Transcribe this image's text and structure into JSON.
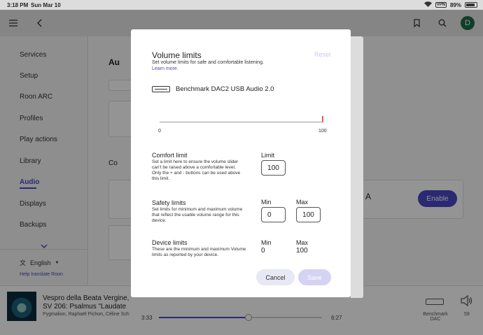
{
  "status_bar": {
    "time": "3:18 PM",
    "date": "Sun Mar 10",
    "battery": "89%",
    "battery_level": 0.89
  },
  "sidebar": {
    "items": [
      {
        "label": "Services"
      },
      {
        "label": "Setup"
      },
      {
        "label": "Roon ARC"
      },
      {
        "label": "Profiles"
      },
      {
        "label": "Play actions"
      },
      {
        "label": "Library"
      },
      {
        "label": "Audio"
      },
      {
        "label": "Displays"
      },
      {
        "label": "Backups"
      }
    ],
    "language": "English",
    "help_link": "Help translate Roon"
  },
  "background": {
    "title_fragment": "Au",
    "section_fragment": "Co",
    "card_fragment": "MI A",
    "enable_label": "Enable"
  },
  "avatar_initial": "D",
  "modal": {
    "title": "Volume limits",
    "subtitle": "Set volume limits for safe and comfortable listening.",
    "learn_more": "Learn more.",
    "reset": "Reset",
    "device_name": "Benchmark DAC2 USB Audio 2.0",
    "slider": {
      "min_label": "0",
      "max_label": "100"
    },
    "comfort": {
      "heading": "Comfort limit",
      "description": "Set a limit here to ensure the volume slider can't be raised above a comfortable level. Only the + and - buttons can be used above this limit.",
      "limit_label": "Limit",
      "limit_value": "100"
    },
    "safety": {
      "heading": "Safety limits",
      "description": "Set limits for minimum and maximum volume that reflect the usable volume range for this device.",
      "min_label": "Min",
      "max_label": "Max",
      "min_value": "0",
      "max_value": "100"
    },
    "device": {
      "heading": "Device limits",
      "description": "These are the minimum and maximum Volume limits as reported by your device.",
      "min_label": "Min",
      "max_label": "Max",
      "min_value": "0",
      "max_value": "100"
    },
    "cancel": "Cancel",
    "save": "Save"
  },
  "now_playing": {
    "title_line1": "Vespro della Beata Vergine,",
    "title_line2": "SV 206: Psalmus \"Laudate",
    "artist": "Pygmalion, Raphaël Pichon, Céline Sch",
    "elapsed": "3:33",
    "duration": "6:27",
    "progress": 0.55,
    "device_line1": "Benchmark",
    "device_line2": "DAC",
    "volume": "59"
  },
  "colors": {
    "accent": "#4b48c4",
    "avatar": "#1c6b46"
  }
}
